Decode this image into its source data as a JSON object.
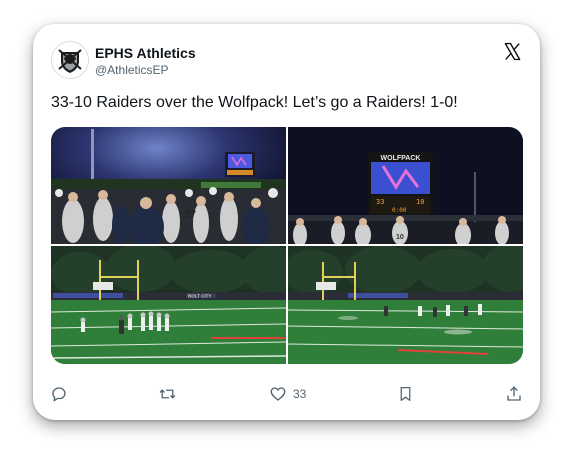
{
  "account": {
    "name": "EPHS Athletics",
    "handle": "@AthleticsEP"
  },
  "tweet": {
    "text": "33-10 Raiders over the Wolfpack! Let’s go a Raiders! 1-0!"
  },
  "photos": {
    "scoreboard_small_label": "",
    "scoreboard_title": "WOLFPACK",
    "banner_text": "BOLT CITY"
  },
  "actions": {
    "like_count": "33"
  },
  "icons": {
    "logo": "raiders-shield-logo",
    "close": "x-logo-icon",
    "reply": "reply-icon",
    "repost": "repost-icon",
    "like": "heart-icon",
    "bookmark": "bookmark-icon",
    "share": "share-icon"
  },
  "colors": {
    "text": "#0f1419",
    "secondary": "#536471",
    "field_green": "#2f7f3a",
    "scoreboard_blue": "#3b4fd1"
  }
}
